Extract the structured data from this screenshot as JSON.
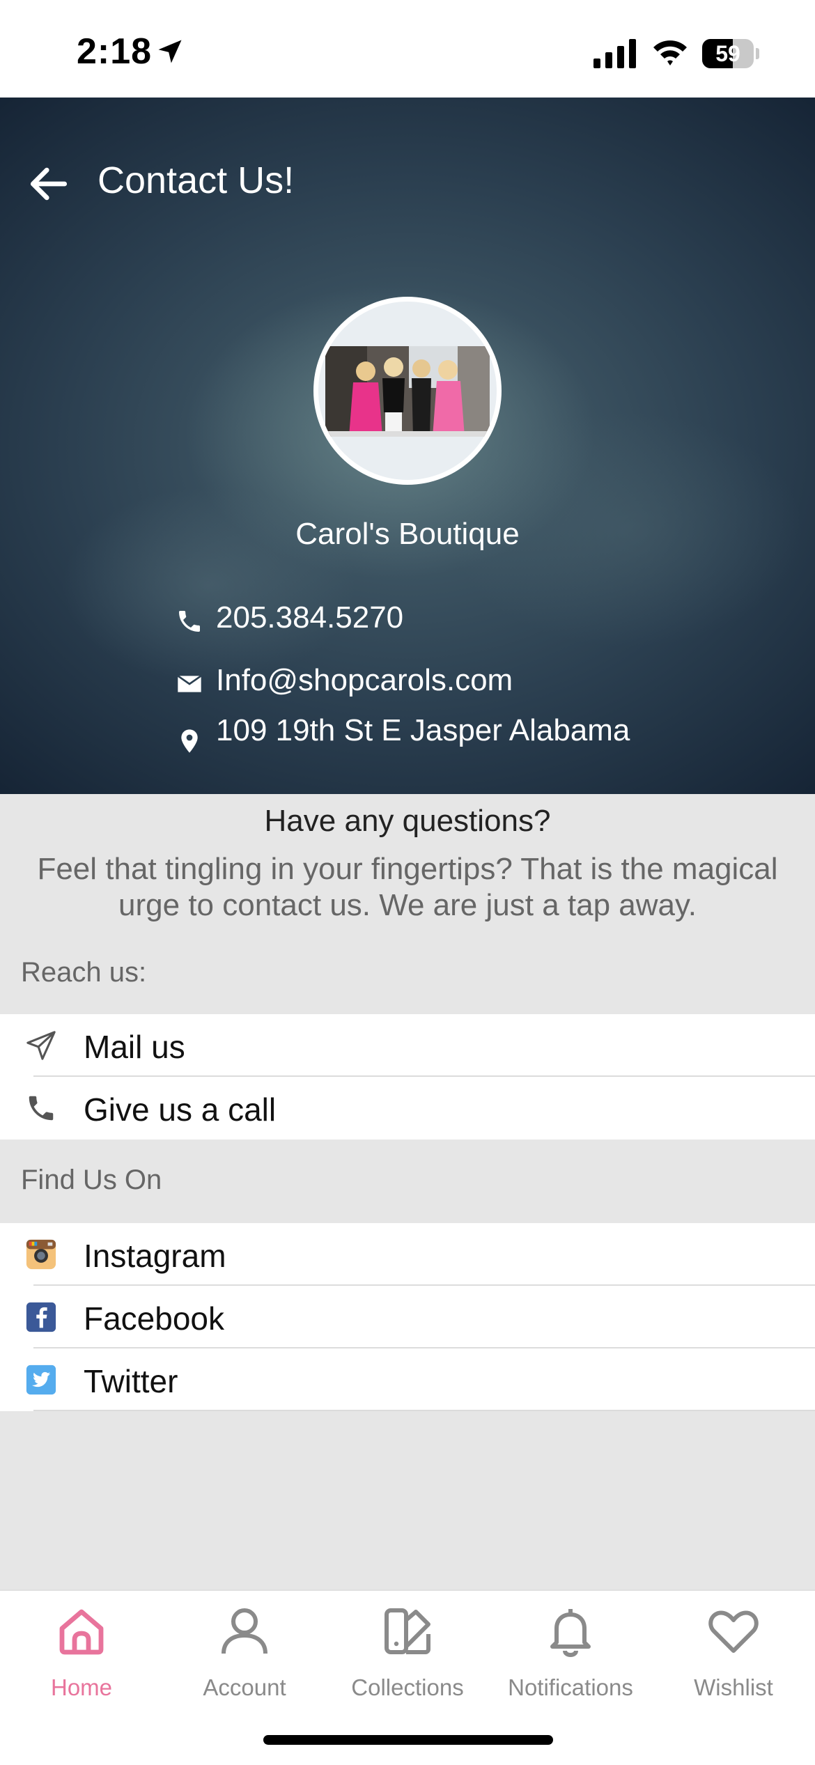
{
  "status_bar": {
    "time": "2:18",
    "battery": "59",
    "battery_level": 0.59,
    "icons": [
      "location-arrow-icon",
      "cellular-signal-icon",
      "wifi-icon",
      "battery-icon"
    ]
  },
  "header": {
    "title": "Contact Us!",
    "back_icon": "arrow-left-icon"
  },
  "profile": {
    "store_name": "Carol's Boutique",
    "phone": "205.384.5270",
    "email": "Info@shopcarols.com",
    "address": "109 19th St E Jasper Alabama"
  },
  "questions": {
    "title": "Have any questions?",
    "description": "Feel that tingling in your fingertips? That is the magical urge to contact us. We are just a tap away."
  },
  "reach_us": {
    "label": "Reach us:",
    "items": [
      {
        "label": "Mail us",
        "icon": "paper-plane-icon"
      },
      {
        "label": "Give us a call",
        "icon": "phone-icon"
      }
    ]
  },
  "find_us": {
    "label": "Find Us On",
    "items": [
      {
        "label": "Instagram",
        "icon": "instagram-icon"
      },
      {
        "label": "Facebook",
        "icon": "facebook-icon"
      },
      {
        "label": "Twitter",
        "icon": "twitter-icon"
      }
    ]
  },
  "tab_bar": {
    "items": [
      {
        "label": "Home",
        "icon": "home-icon",
        "active": true
      },
      {
        "label": "Account",
        "icon": "user-icon",
        "active": false
      },
      {
        "label": "Collections",
        "icon": "collections-icon",
        "active": false
      },
      {
        "label": "Notifications",
        "icon": "bell-icon",
        "active": false
      },
      {
        "label": "Wishlist",
        "icon": "heart-icon",
        "active": false
      }
    ]
  },
  "colors": {
    "accent": "#e8749c",
    "inactive": "#8a8a8a",
    "hero_dark": "#1d2e3e",
    "instagram": "#f4c27a",
    "facebook": "#3b5998",
    "twitter": "#55acee"
  }
}
